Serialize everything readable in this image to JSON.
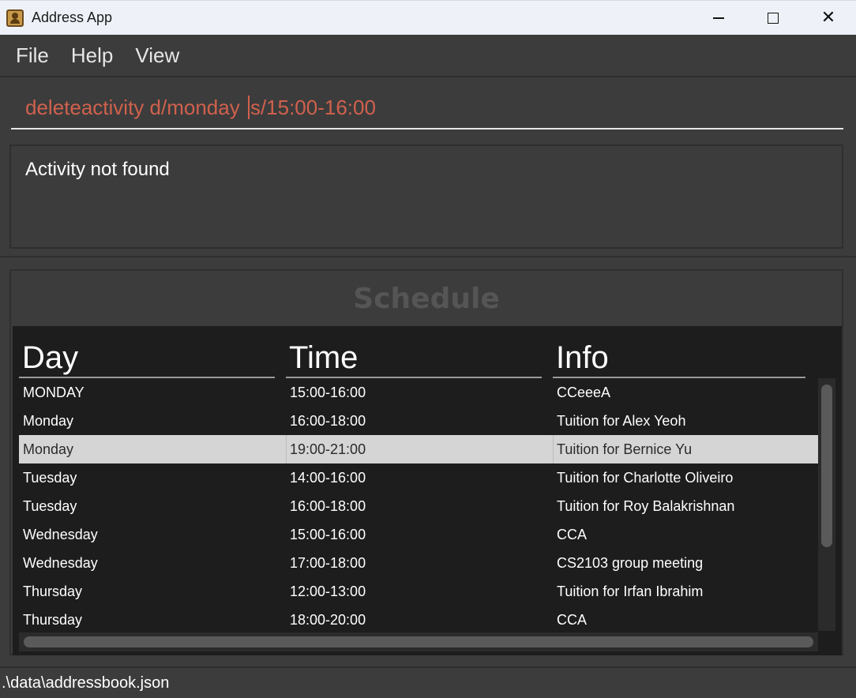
{
  "window": {
    "title": "Address App",
    "icon": "address-book-icon"
  },
  "menu": {
    "items": [
      {
        "label": "File"
      },
      {
        "label": "Help"
      },
      {
        "label": "View"
      }
    ]
  },
  "command": {
    "value_before_caret": "deleteactivity d/monday ",
    "value_after_caret": "s/15:00-16:00",
    "text_color": "#d0614d"
  },
  "result": {
    "message": "Activity not found"
  },
  "schedule": {
    "title": "Schedule",
    "columns": [
      "Day",
      "Time",
      "Info"
    ],
    "selected_row_index": 2,
    "rows": [
      {
        "day": "MONDAY",
        "time": "15:00-16:00",
        "info": "CCeeeA"
      },
      {
        "day": "Monday",
        "time": "16:00-18:00",
        "info": "Tuition for Alex Yeoh"
      },
      {
        "day": "Monday",
        "time": "19:00-21:00",
        "info": "Tuition for Bernice Yu"
      },
      {
        "day": "Tuesday",
        "time": "14:00-16:00",
        "info": "Tuition for Charlotte Oliveiro"
      },
      {
        "day": "Tuesday",
        "time": "16:00-18:00",
        "info": "Tuition for Roy Balakrishnan"
      },
      {
        "day": "Wednesday",
        "time": "15:00-16:00",
        "info": "CCA"
      },
      {
        "day": "Wednesday",
        "time": "17:00-18:00",
        "info": "CS2103 group meeting"
      },
      {
        "day": "Thursday",
        "time": "12:00-13:00",
        "info": "Tuition for Irfan Ibrahim"
      },
      {
        "day": "Thursday",
        "time": "18:00-20:00",
        "info": "CCA"
      }
    ]
  },
  "status": {
    "file_path": ".\\data\\addressbook.json"
  },
  "colors": {
    "background": "#3c3c3c",
    "table_background": "#1d1d1d",
    "selected_row": "#d5d5d5",
    "title_bar": "#eef2f8"
  }
}
